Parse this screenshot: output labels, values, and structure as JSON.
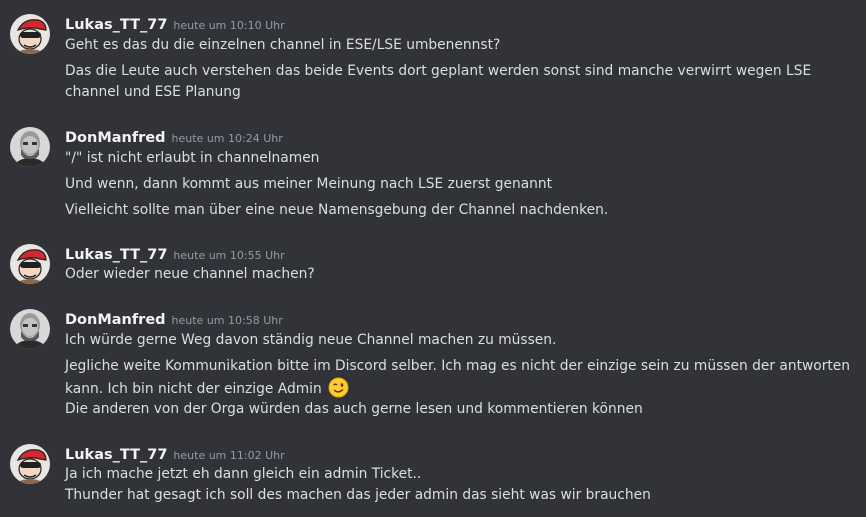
{
  "messages": [
    {
      "author": "Lukas_TT_77",
      "avatar_icon": "red-cap-mascot-avatar",
      "time": "heute um 10:10 Uhr",
      "lines": [
        "Geht es das du die einzelnen channel in ESE/LSE umbenennst?",
        "Das die Leute auch verstehen das beide Events dort geplant werden sonst sind manche verwirrt wegen  LSE",
        "channel und ESE Planung"
      ]
    },
    {
      "author": "DonManfred",
      "avatar_icon": "grayscale-bearded-man-avatar",
      "time": "heute um 10:24 Uhr",
      "lines": [
        "\"/\" ist nicht erlaubt in channelnamen",
        "Und wenn, dann kommt aus meiner Meinung nach LSE zuerst genannt",
        "Vielleicht sollte man über eine neue Namensgebung der Channel nachdenken."
      ]
    },
    {
      "author": "Lukas_TT_77",
      "avatar_icon": "red-cap-mascot-avatar",
      "time": "heute um 10:55 Uhr",
      "lines": [
        "Oder wieder neue channel machen?"
      ]
    },
    {
      "author": "DonManfred",
      "avatar_icon": "grayscale-bearded-man-avatar",
      "time": "heute um 10:58 Uhr",
      "lines": [
        "Ich würde gerne Weg davon ständig neue Channel machen zu müssen.",
        "Jegliche weite Kommunikation bitte im Discord selber. Ich mag es nicht der einzige sein zu müssen der antworten",
        "kann. Ich bin nicht der einzige Admin",
        "Die anderen von der Orga würden das auch gerne lesen und kommentieren können"
      ],
      "emoji": "winking-face-emoji"
    },
    {
      "author": "Lukas_TT_77",
      "avatar_icon": "red-cap-mascot-avatar",
      "time": "heute um 11:02 Uhr",
      "lines": [
        "Ja ich mache jetzt eh dann gleich ein admin Ticket..",
        "Thunder hat gesagt ich soll des machen das jeder admin das sieht was wir brauchen"
      ]
    }
  ],
  "colors": {
    "background": "#313338",
    "username": "#f2f3f5",
    "timestamp": "#949ba4",
    "text": "#dbdee1"
  }
}
